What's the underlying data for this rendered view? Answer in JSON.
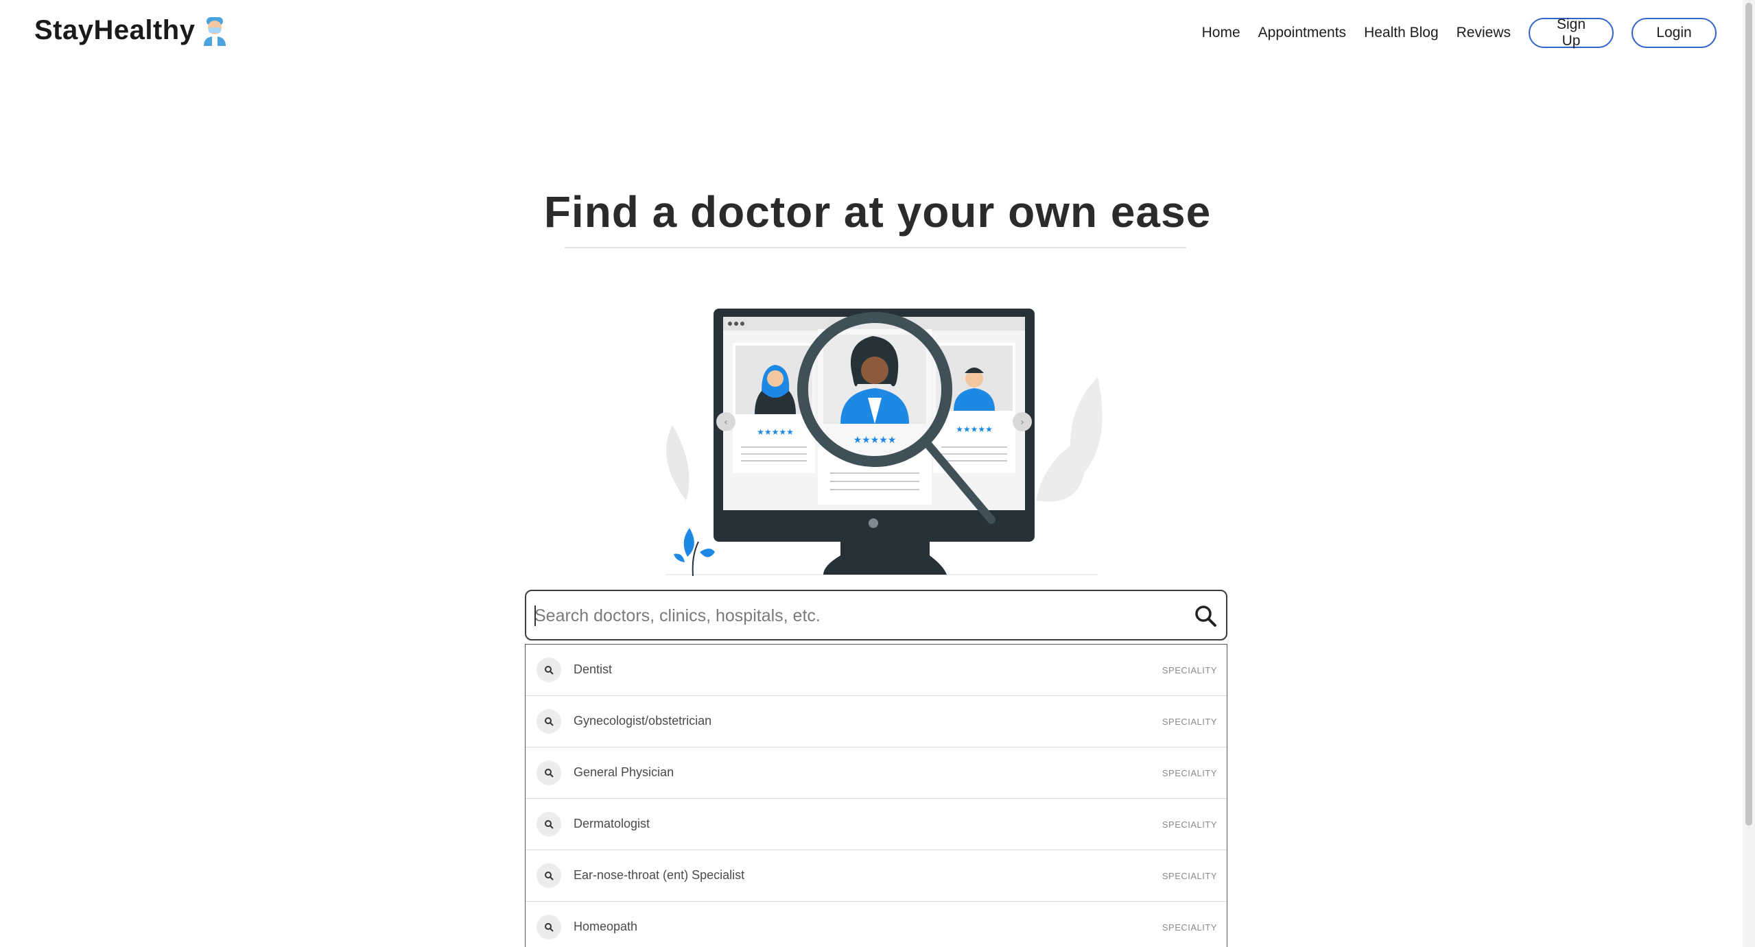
{
  "nav": {
    "brand": "StayHealthy",
    "links": [
      "Home",
      "Appointments",
      "Health Blog",
      "Reviews"
    ],
    "signup_label": "Sign Up",
    "login_label": "Login"
  },
  "hero": {
    "title": "Find a doctor at your own ease"
  },
  "search": {
    "placeholder": "Search doctors, clinics, hospitals, etc.",
    "value": ""
  },
  "suggestions": [
    {
      "label": "Dentist",
      "type": "SPECIALITY"
    },
    {
      "label": "Gynecologist/obstetrician",
      "type": "SPECIALITY"
    },
    {
      "label": "General Physician",
      "type": "SPECIALITY"
    },
    {
      "label": "Dermatologist",
      "type": "SPECIALITY"
    },
    {
      "label": "Ear-nose-throat (ent) Specialist",
      "type": "SPECIALITY"
    },
    {
      "label": "Homeopath",
      "type": "SPECIALITY"
    }
  ],
  "colors": {
    "accent": "#2f64c9",
    "illustration_blue": "#1e88e5",
    "monitor_dark": "#263238"
  },
  "icons": {
    "search": "search-icon",
    "suggestion": "search-icon"
  }
}
